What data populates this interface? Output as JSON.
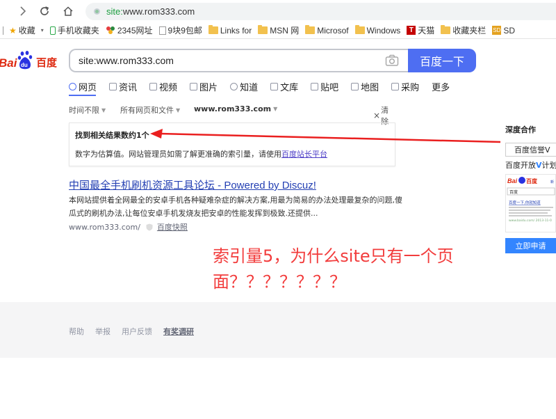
{
  "browser": {
    "url_scheme": "site:",
    "url_rest": "www.rom333.com",
    "bookmarks": [
      {
        "icon": "star-icon",
        "label": "收藏"
      },
      {
        "icon": "phone-icon",
        "label": "手机收藏夹"
      },
      {
        "icon": "2345-icon",
        "label": "2345网址"
      },
      {
        "icon": "doc-icon",
        "label": "9块9包邮"
      },
      {
        "icon": "folder-icon",
        "label": "Links for"
      },
      {
        "icon": "folder-icon",
        "label": "MSN 网"
      },
      {
        "icon": "folder-icon",
        "label": "Microsof"
      },
      {
        "icon": "folder-icon",
        "label": "Windows"
      },
      {
        "icon": "tmall-icon",
        "label": "天猫"
      },
      {
        "icon": "folder-icon",
        "label": "收藏夹栏"
      },
      {
        "icon": "sd-icon",
        "label": "SD"
      }
    ]
  },
  "search": {
    "query": "site:www.rom333.com",
    "button_label": "百度一下"
  },
  "tabs": [
    {
      "label": "网页",
      "active": true
    },
    {
      "label": "资讯"
    },
    {
      "label": "视频"
    },
    {
      "label": "图片"
    },
    {
      "label": "知道"
    },
    {
      "label": "文库"
    },
    {
      "label": "贴吧"
    },
    {
      "label": "地图"
    },
    {
      "label": "采购"
    },
    {
      "label": "更多"
    }
  ],
  "filters": {
    "time": "时间不限",
    "type": "所有网页和文件",
    "site": "www.rom333.com",
    "clear": "清除"
  },
  "count_box": {
    "title": "找到相关结果数约1个",
    "note": "数字为估算值。网站管理员如需了解更准确的索引量，请使用",
    "link": "百度站长平台"
  },
  "result": {
    "title": "中国最全手机刷机资源工具论坛 - Powered by Discuz!",
    "abstract": "本网站提供着全网最全的安卓手机各种疑难杂症的解决方案,用最为简易的办法处理最复杂的问题,傻瓜式的刷机办法,让每位安卓手机发烧友把安卓的性能发挥到极致.还提供...",
    "url": "www.rom333.com/",
    "cache": "百度快照"
  },
  "sidebar": {
    "title": "深度合作",
    "tab": "百度信誉V",
    "open_prefix": "百度开放",
    "open_v": "V",
    "open_suffix": "计划",
    "apply": "立即申请",
    "preview_search": "百度",
    "preview_link": "百度一下,你就知道",
    "preview_url": "www.baidu.com/ 2013-11-0"
  },
  "annotation": "索引量5，为什么site只有一个页面？？？？？？？",
  "footer": {
    "links": [
      "帮助",
      "举报",
      "用户反馈",
      "有奖调研"
    ]
  },
  "colors": {
    "baidu_blue": "#4e6ef2",
    "link_blue": "#2440b3",
    "annotation_red": "#f23c3c"
  }
}
